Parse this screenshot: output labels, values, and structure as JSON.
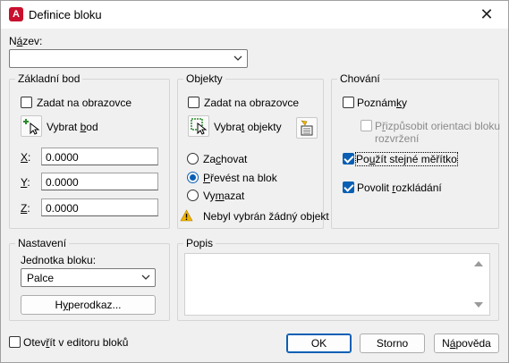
{
  "window": {
    "title": "Definice bloku",
    "app_icon_letter": "A",
    "close_glyph": "✕"
  },
  "name": {
    "label_prefix": "N",
    "label_accel": "á",
    "label_suffix": "zev:",
    "value": ""
  },
  "base_point": {
    "title": "Základní bod",
    "specify_on_screen": "Zadat na obrazovce",
    "specify_checked": false,
    "pick_label_prefix": "Vybrat ",
    "pick_label_accel": "b",
    "pick_label_suffix": "od",
    "x_label": "X",
    "y_label": "Y",
    "z_label": "Z",
    "colon": ":",
    "x_value": "0.0000",
    "y_value": "0.0000",
    "z_value": "0.0000"
  },
  "objects": {
    "title": "Objekty",
    "specify_on_screen": "Zadat na obrazovce",
    "specify_checked": false,
    "select_label_prefix": "Vybra",
    "select_label_accel": "t",
    "select_label_suffix": " objekty",
    "retain_prefix": "Za",
    "retain_accel": "c",
    "retain_suffix": "hovat",
    "convert_accel": "P",
    "convert_suffix": "řevést na blok",
    "delete_prefix": "Vy",
    "delete_accel": "m",
    "delete_suffix": "azat",
    "selected_option": "convert",
    "warning": "Nebyl vybrán žádný objekt",
    "warning_icon": "warning-icon"
  },
  "behavior": {
    "title": "Chování",
    "annotative_prefix": "Poznám",
    "annotative_accel": "k",
    "annotative_suffix": "y",
    "annotative_checked": false,
    "match_orientation_line1_prefix": "P",
    "match_orientation_line1_accel": "ř",
    "match_orientation_line1_suffix": "izpůsobit orientaci bloku",
    "match_orientation_line2": "rozvržení",
    "match_orientation_checked": false,
    "uniform_scale_prefix": "Po",
    "uniform_scale_accel": "u",
    "uniform_scale_suffix": "žít stejné měřítko",
    "uniform_scale_checked": true,
    "allow_explode_prefix": "Povolit ",
    "allow_explode_accel": "r",
    "allow_explode_suffix": "ozkládání",
    "allow_explode_checked": true
  },
  "settings": {
    "title": "Nastavení",
    "unit_label": "Jednotka bloku:",
    "unit_value": "Palce",
    "hyperlink_prefix": "H",
    "hyperlink_accel": "y",
    "hyperlink_suffix": "perodkaz..."
  },
  "description": {
    "title": "Popis",
    "value": ""
  },
  "footer": {
    "open_in_editor_prefix": "Otev",
    "open_in_editor_accel": "ř",
    "open_in_editor_suffix": "ít v editoru bloků",
    "open_in_editor_checked": false,
    "ok": "OK",
    "cancel": "Storno",
    "help_prefix": "N",
    "help_accel": "á",
    "help_suffix": "pověda"
  },
  "colors": {
    "accent": "#0a5fb4",
    "app_icon": "#c8102e",
    "warning": "#f0b400"
  }
}
